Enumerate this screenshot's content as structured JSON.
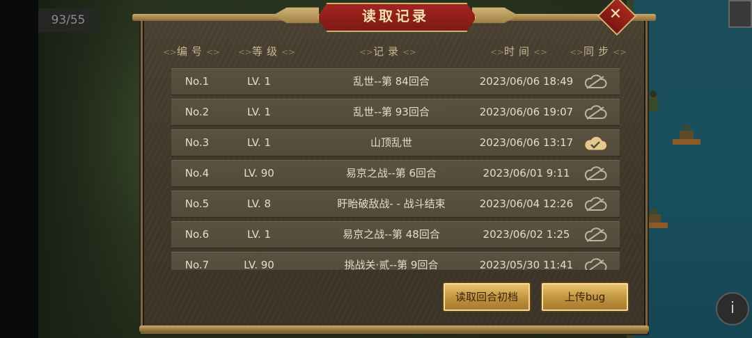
{
  "counter": "93/55",
  "dialog": {
    "title": "读取记录",
    "close_label": "✕"
  },
  "headers": {
    "no": "编号",
    "level": "等级",
    "record": "记录",
    "time": "时间",
    "sync": "同步"
  },
  "rows": [
    {
      "no": "No.1",
      "level": "LV. 1",
      "record": "乱世--第 84回合",
      "time": "2023/06/06 18:49",
      "sync": "not-synced"
    },
    {
      "no": "No.2",
      "level": "LV. 1",
      "record": "乱世--第 93回合",
      "time": "2023/06/06 19:07",
      "sync": "not-synced"
    },
    {
      "no": "No.3",
      "level": "LV. 1",
      "record": "山顶乱世",
      "time": "2023/06/06 13:17",
      "sync": "synced"
    },
    {
      "no": "No.4",
      "level": "LV. 90",
      "record": "易京之战--第 6回合",
      "time": "2023/06/01 9:11",
      "sync": "not-synced"
    },
    {
      "no": "No.5",
      "level": "LV. 8",
      "record": "盱眙破敌战- - 战斗结束",
      "time": "2023/06/04 12:26",
      "sync": "not-synced"
    },
    {
      "no": "No.6",
      "level": "LV. 1",
      "record": "易京之战--第 48回合",
      "time": "2023/06/02 1:25",
      "sync": "not-synced"
    },
    {
      "no": "No.7",
      "level": "LV. 90",
      "record": "挑战关·贰--第 9回合",
      "time": "2023/05/30 11:41",
      "sync": "not-synced"
    }
  ],
  "buttons": {
    "load_turn_start": "读取回合初档",
    "upload_bug": "上传bug"
  },
  "colors": {
    "title_red": "#a2251f",
    "gold": "#d2b36e",
    "row_bg": "#5b5140",
    "cloud_synced": "#e3c98e",
    "cloud_outline": "#bdb5a3"
  }
}
